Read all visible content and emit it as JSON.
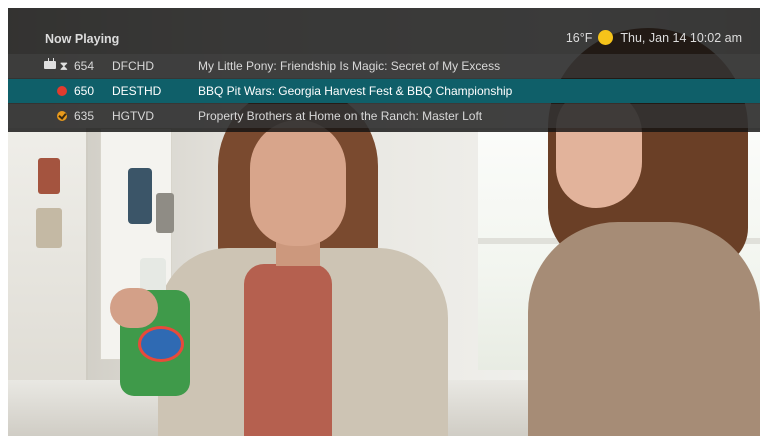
{
  "header": {
    "title": "Now Playing",
    "temperature": "16°F",
    "weather_icon": "sun-icon",
    "datetime": "Thu, Jan 14 10:02 am"
  },
  "channels": [
    {
      "number": "654",
      "name": "DFCHD",
      "program": "My Little Pony: Friendship Is Magic: Secret of My Excess",
      "icons": [
        "tv-icon",
        "hourglass-icon"
      ]
    },
    {
      "number": "650",
      "name": "DESTHD",
      "program": "BBQ Pit Wars: Georgia Harvest Fest & BBQ Championship",
      "icons": [
        "rec-icon"
      ],
      "selected": true
    },
    {
      "number": "635",
      "name": "HGTVD",
      "program": "Property Brothers at Home on the Ranch: Master Loft",
      "icons": [
        "check-icon"
      ]
    }
  ],
  "colors": {
    "selected_row": "#0f5f69",
    "overlay": "#121212",
    "record": "#e23b2e",
    "weather": "#f5c31a"
  }
}
